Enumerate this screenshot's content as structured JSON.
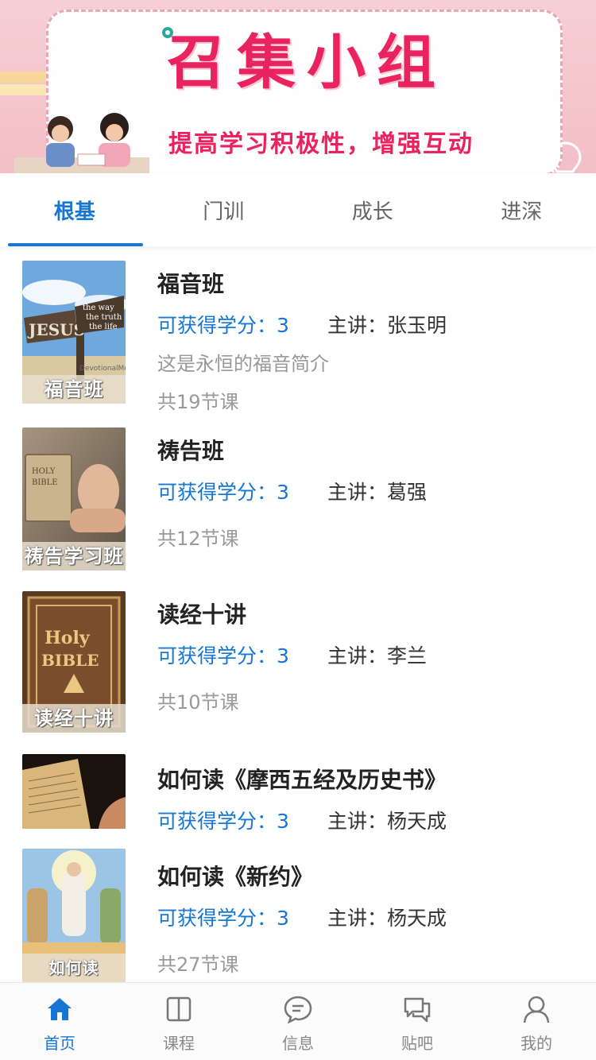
{
  "banner": {
    "title": "召集小组",
    "subtitle": "提高学习积极性，增强互动"
  },
  "tabs": [
    {
      "label": "根基",
      "active": true
    },
    {
      "label": "门训",
      "active": false
    },
    {
      "label": "成长",
      "active": false
    },
    {
      "label": "进深",
      "active": false
    }
  ],
  "courses": [
    {
      "title": "福音班",
      "credits": "可获得学分：3",
      "lecturer": "主讲：张玉明",
      "description": "这是永恒的福音简介",
      "lessons": "共19节课",
      "thumb_caption": "福音班",
      "thumb_sign": "JESUS",
      "thumb_sign_text": [
        "the way",
        "the truth",
        "the life"
      ],
      "thumb_watermark": "DevotionalMo"
    },
    {
      "title": "祷告班",
      "credits": "可获得学分：3",
      "lecturer": "主讲：葛强",
      "lessons": "共12节课",
      "thumb_caption": "祷告学习班",
      "thumb_book_text": [
        "HOLY",
        "BIBLE"
      ]
    },
    {
      "title": "读经十讲",
      "credits": "可获得学分：3",
      "lecturer": "主讲：李兰",
      "lessons": "共10节课",
      "thumb_caption": "读经十讲",
      "thumb_book_text": [
        "Holy",
        "BIBLE"
      ]
    },
    {
      "title": "如何读《摩西五经及历史书》",
      "credits": "可获得学分：3",
      "lecturer": "主讲：杨天成"
    },
    {
      "title": "如何读《新约》",
      "credits": "可获得学分：3",
      "lecturer": "主讲：杨天成",
      "lessons": "共27节课",
      "thumb_caption": "如何读"
    }
  ],
  "nav": [
    {
      "label": "首页",
      "icon": "home-icon",
      "active": true
    },
    {
      "label": "课程",
      "icon": "book-icon",
      "active": false
    },
    {
      "label": "信息",
      "icon": "message-icon",
      "active": false
    },
    {
      "label": "贴吧",
      "icon": "forum-icon",
      "active": false
    },
    {
      "label": "我的",
      "icon": "user-icon",
      "active": false
    }
  ],
  "colors": {
    "accent": "#1677d2",
    "banner_text": "#e8235f",
    "muted": "#999999"
  }
}
